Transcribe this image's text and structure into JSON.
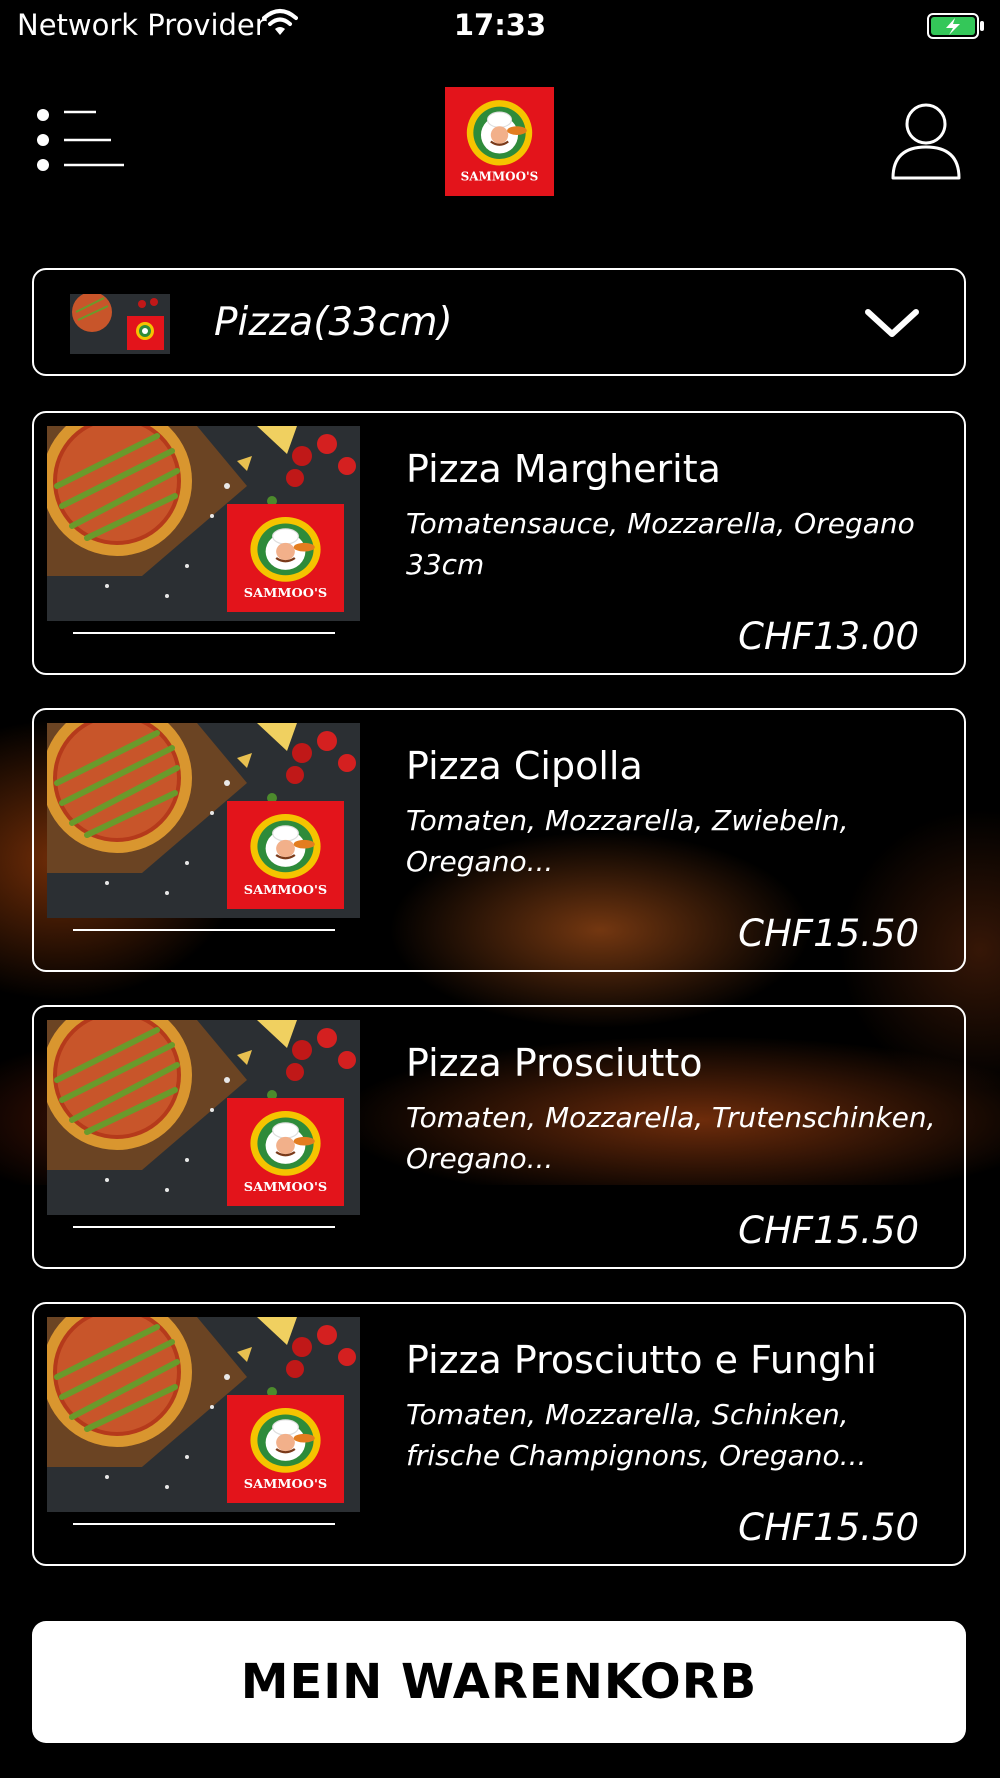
{
  "status_bar": {
    "carrier": "Network Provider",
    "time": "17:33",
    "wifi_icon": "wifi-icon",
    "battery_icon": "battery-charging-icon"
  },
  "header": {
    "menu_icon": "menu-list-icon",
    "logo_text": "SAMMOO'S",
    "profile_icon": "user-icon",
    "brand_color": "#e3141b"
  },
  "category": {
    "label": "Pizza(33cm)",
    "chevron_icon": "chevron-down-icon"
  },
  "products": [
    {
      "title": "Pizza Margherita",
      "description": "Tomatensauce, Mozzarella, Oregano 33cm",
      "price": "CHF13.00"
    },
    {
      "title": "Pizza Cipolla",
      "description": "Tomaten, Mozzarella, Zwiebeln, Oregano...",
      "price": "CHF15.50"
    },
    {
      "title": "Pizza Prosciutto",
      "description": "Tomaten, Mozzarella, Trutenschinken, Oregano...",
      "price": "CHF15.50"
    },
    {
      "title": "Pizza Prosciutto e Funghi",
      "description": "Tomaten, Mozzarella, Schinken, frische Champignons, Oregano...",
      "price": "CHF15.50"
    }
  ],
  "cart": {
    "label": "MEIN WARENKORB"
  }
}
